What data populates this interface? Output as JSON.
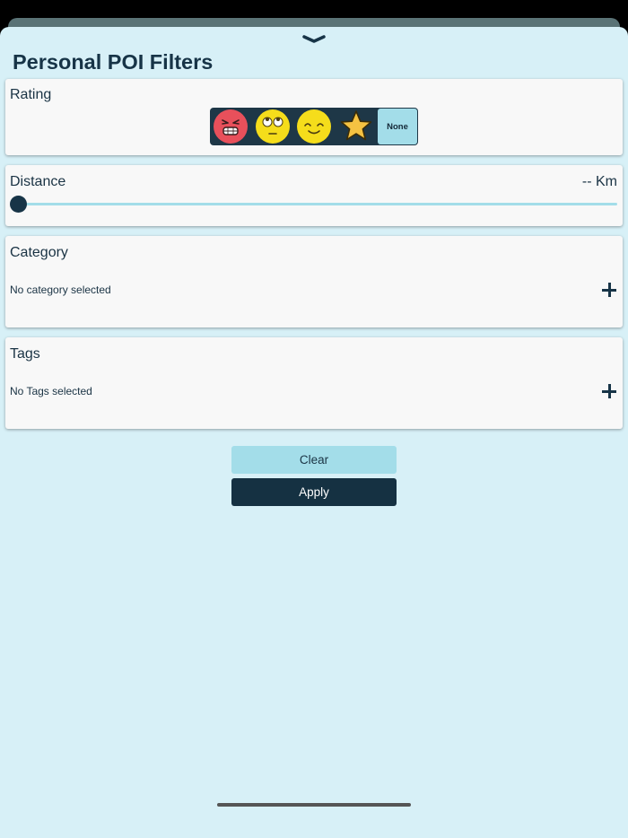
{
  "sheet": {
    "title": "Personal POI Filters",
    "grabber_icon": "chevron-down-icon"
  },
  "rating": {
    "label": "Rating",
    "options": [
      {
        "icon": "angry-face-icon"
      },
      {
        "icon": "eye-roll-face-icon"
      },
      {
        "icon": "smiling-face-icon"
      },
      {
        "icon": "star-icon"
      }
    ],
    "none_label": "None",
    "selected": "None"
  },
  "distance": {
    "label": "Distance",
    "value_text": "-- Km",
    "slider_value": 0
  },
  "category": {
    "label": "Category",
    "empty_text": "No category selected",
    "add_icon": "plus-icon"
  },
  "tags": {
    "label": "Tags",
    "empty_text": "No Tags selected",
    "add_icon": "plus-icon"
  },
  "actions": {
    "clear_label": "Clear",
    "apply_label": "Apply"
  },
  "colors": {
    "background": "#d7f0f7",
    "primary_dark": "#153142",
    "accent_light": "#a3dde9",
    "card": "#f8f8f8"
  }
}
